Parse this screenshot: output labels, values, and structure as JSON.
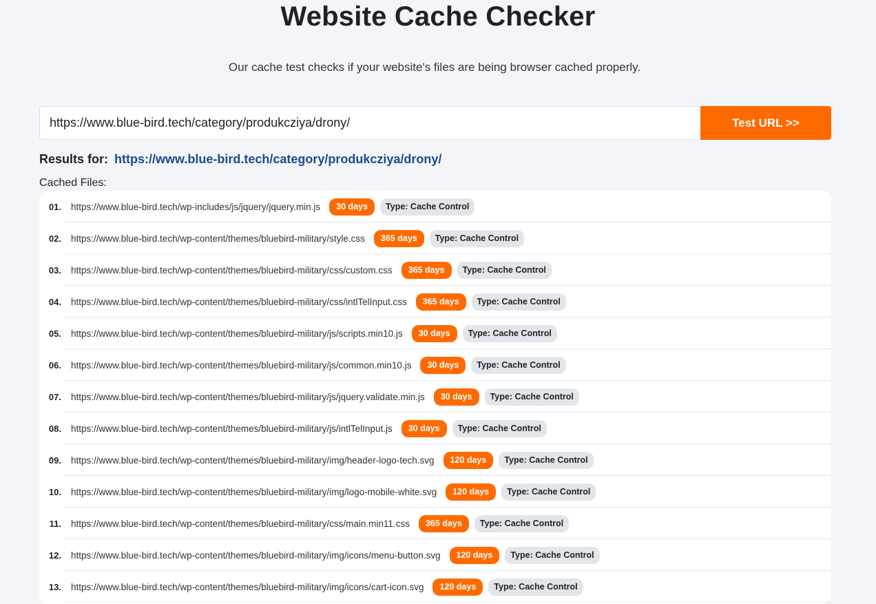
{
  "header": {
    "title": "Website Cache Checker",
    "subtitle": "Our cache test checks if your website's files are being browser cached properly."
  },
  "form": {
    "url_value": "https://www.blue-bird.tech/category/produkcziya/drony/",
    "button_label": "Test URL >>"
  },
  "results": {
    "label": "Results for:",
    "url": "https://www.blue-bird.tech/category/produkcziya/drony/",
    "cached_heading": "Cached Files:",
    "files": [
      {
        "num": "01.",
        "url": "https://www.blue-bird.tech/wp-includes/js/jquery/jquery.min.js",
        "age": "30 days",
        "type": "Type: Cache Control"
      },
      {
        "num": "02.",
        "url": "https://www.blue-bird.tech/wp-content/themes/bluebird-military/style.css",
        "age": "365 days",
        "type": "Type: Cache Control"
      },
      {
        "num": "03.",
        "url": "https://www.blue-bird.tech/wp-content/themes/bluebird-military/css/custom.css",
        "age": "365 days",
        "type": "Type: Cache Control"
      },
      {
        "num": "04.",
        "url": "https://www.blue-bird.tech/wp-content/themes/bluebird-military/css/intlTelInput.css",
        "age": "365 days",
        "type": "Type: Cache Control"
      },
      {
        "num": "05.",
        "url": "https://www.blue-bird.tech/wp-content/themes/bluebird-military/js/scripts.min10.js",
        "age": "30 days",
        "type": "Type: Cache Control"
      },
      {
        "num": "06.",
        "url": "https://www.blue-bird.tech/wp-content/themes/bluebird-military/js/common.min10.js",
        "age": "30 days",
        "type": "Type: Cache Control"
      },
      {
        "num": "07.",
        "url": "https://www.blue-bird.tech/wp-content/themes/bluebird-military/js/jquery.validate.min.js",
        "age": "30 days",
        "type": "Type: Cache Control"
      },
      {
        "num": "08.",
        "url": "https://www.blue-bird.tech/wp-content/themes/bluebird-military/js/intlTelInput.js",
        "age": "30 days",
        "type": "Type: Cache Control"
      },
      {
        "num": "09.",
        "url": "https://www.blue-bird.tech/wp-content/themes/bluebird-military/img/header-logo-tech.svg",
        "age": "120 days",
        "type": "Type: Cache Control"
      },
      {
        "num": "10.",
        "url": "https://www.blue-bird.tech/wp-content/themes/bluebird-military/img/logo-mobile-white.svg",
        "age": "120 days",
        "type": "Type: Cache Control"
      },
      {
        "num": "11.",
        "url": "https://www.blue-bird.tech/wp-content/themes/bluebird-military/css/main.min11.css",
        "age": "365 days",
        "type": "Type: Cache Control"
      },
      {
        "num": "12.",
        "url": "https://www.blue-bird.tech/wp-content/themes/bluebird-military/img/icons/menu-button.svg",
        "age": "120 days",
        "type": "Type: Cache Control"
      },
      {
        "num": "13.",
        "url": "https://www.blue-bird.tech/wp-content/themes/bluebird-military/img/icons/cart-icon.svg",
        "age": "120 days",
        "type": "Type: Cache Control"
      }
    ]
  },
  "colors": {
    "accent": "#ff6a00",
    "link": "#1e4a8c",
    "background": "#f4f5f9",
    "type_badge": "#e2e5ea"
  }
}
